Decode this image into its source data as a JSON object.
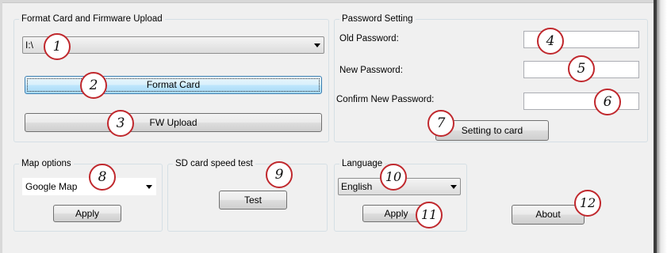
{
  "colors": {
    "marker_border": "#c0282d",
    "focus_border": "#3c7fb1",
    "window_bg": "#f0f0f0"
  },
  "format_group": {
    "title": "Format Card and Firmware Upload",
    "drive_select": "I:\\",
    "format_button": "Format Card",
    "fw_upload_button": "FW Upload"
  },
  "password_group": {
    "title": "Password Setting",
    "old_label": "Old Password:",
    "new_label": "New Password:",
    "confirm_label": "Confirm New Password:",
    "old_value": "",
    "new_value": "",
    "confirm_value": "",
    "setting_button": "Setting to card"
  },
  "map_group": {
    "title": "Map options",
    "selected": "Google Map",
    "apply_button": "Apply"
  },
  "speed_group": {
    "title": "SD card speed test",
    "test_button": "Test"
  },
  "language_group": {
    "title": "Language",
    "selected": "English",
    "apply_button": "Apply"
  },
  "about_button": "About",
  "markers": [
    "1",
    "2",
    "3",
    "4",
    "5",
    "6",
    "7",
    "8",
    "9",
    "10",
    "11",
    "12"
  ]
}
